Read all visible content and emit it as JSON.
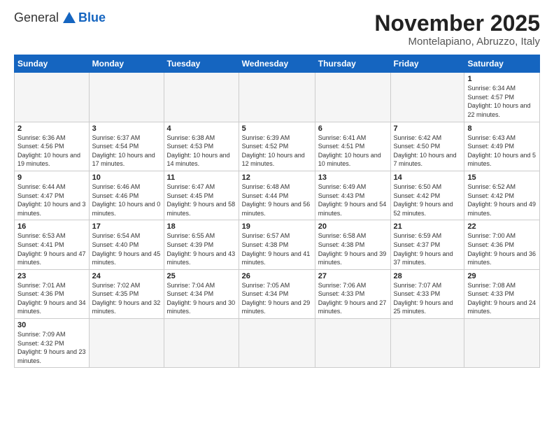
{
  "logo": {
    "general": "General",
    "blue": "Blue"
  },
  "title": "November 2025",
  "subtitle": "Montelapiano, Abruzzo, Italy",
  "days_header": [
    "Sunday",
    "Monday",
    "Tuesday",
    "Wednesday",
    "Thursday",
    "Friday",
    "Saturday"
  ],
  "weeks": [
    [
      {
        "num": "",
        "info": "",
        "empty": true
      },
      {
        "num": "",
        "info": "",
        "empty": true
      },
      {
        "num": "",
        "info": "",
        "empty": true
      },
      {
        "num": "",
        "info": "",
        "empty": true
      },
      {
        "num": "",
        "info": "",
        "empty": true
      },
      {
        "num": "",
        "info": "",
        "empty": true
      },
      {
        "num": "1",
        "info": "Sunrise: 6:34 AM\nSunset: 4:57 PM\nDaylight: 10 hours\nand 22 minutes."
      }
    ],
    [
      {
        "num": "2",
        "info": "Sunrise: 6:36 AM\nSunset: 4:56 PM\nDaylight: 10 hours\nand 19 minutes."
      },
      {
        "num": "3",
        "info": "Sunrise: 6:37 AM\nSunset: 4:54 PM\nDaylight: 10 hours\nand 17 minutes."
      },
      {
        "num": "4",
        "info": "Sunrise: 6:38 AM\nSunset: 4:53 PM\nDaylight: 10 hours\nand 14 minutes."
      },
      {
        "num": "5",
        "info": "Sunrise: 6:39 AM\nSunset: 4:52 PM\nDaylight: 10 hours\nand 12 minutes."
      },
      {
        "num": "6",
        "info": "Sunrise: 6:41 AM\nSunset: 4:51 PM\nDaylight: 10 hours\nand 10 minutes."
      },
      {
        "num": "7",
        "info": "Sunrise: 6:42 AM\nSunset: 4:50 PM\nDaylight: 10 hours\nand 7 minutes."
      },
      {
        "num": "8",
        "info": "Sunrise: 6:43 AM\nSunset: 4:49 PM\nDaylight: 10 hours\nand 5 minutes."
      }
    ],
    [
      {
        "num": "9",
        "info": "Sunrise: 6:44 AM\nSunset: 4:47 PM\nDaylight: 10 hours\nand 3 minutes."
      },
      {
        "num": "10",
        "info": "Sunrise: 6:46 AM\nSunset: 4:46 PM\nDaylight: 10 hours\nand 0 minutes."
      },
      {
        "num": "11",
        "info": "Sunrise: 6:47 AM\nSunset: 4:45 PM\nDaylight: 9 hours\nand 58 minutes."
      },
      {
        "num": "12",
        "info": "Sunrise: 6:48 AM\nSunset: 4:44 PM\nDaylight: 9 hours\nand 56 minutes."
      },
      {
        "num": "13",
        "info": "Sunrise: 6:49 AM\nSunset: 4:43 PM\nDaylight: 9 hours\nand 54 minutes."
      },
      {
        "num": "14",
        "info": "Sunrise: 6:50 AM\nSunset: 4:42 PM\nDaylight: 9 hours\nand 52 minutes."
      },
      {
        "num": "15",
        "info": "Sunrise: 6:52 AM\nSunset: 4:42 PM\nDaylight: 9 hours\nand 49 minutes."
      }
    ],
    [
      {
        "num": "16",
        "info": "Sunrise: 6:53 AM\nSunset: 4:41 PM\nDaylight: 9 hours\nand 47 minutes."
      },
      {
        "num": "17",
        "info": "Sunrise: 6:54 AM\nSunset: 4:40 PM\nDaylight: 9 hours\nand 45 minutes."
      },
      {
        "num": "18",
        "info": "Sunrise: 6:55 AM\nSunset: 4:39 PM\nDaylight: 9 hours\nand 43 minutes."
      },
      {
        "num": "19",
        "info": "Sunrise: 6:57 AM\nSunset: 4:38 PM\nDaylight: 9 hours\nand 41 minutes."
      },
      {
        "num": "20",
        "info": "Sunrise: 6:58 AM\nSunset: 4:38 PM\nDaylight: 9 hours\nand 39 minutes."
      },
      {
        "num": "21",
        "info": "Sunrise: 6:59 AM\nSunset: 4:37 PM\nDaylight: 9 hours\nand 37 minutes."
      },
      {
        "num": "22",
        "info": "Sunrise: 7:00 AM\nSunset: 4:36 PM\nDaylight: 9 hours\nand 36 minutes."
      }
    ],
    [
      {
        "num": "23",
        "info": "Sunrise: 7:01 AM\nSunset: 4:36 PM\nDaylight: 9 hours\nand 34 minutes."
      },
      {
        "num": "24",
        "info": "Sunrise: 7:02 AM\nSunset: 4:35 PM\nDaylight: 9 hours\nand 32 minutes."
      },
      {
        "num": "25",
        "info": "Sunrise: 7:04 AM\nSunset: 4:34 PM\nDaylight: 9 hours\nand 30 minutes."
      },
      {
        "num": "26",
        "info": "Sunrise: 7:05 AM\nSunset: 4:34 PM\nDaylight: 9 hours\nand 29 minutes."
      },
      {
        "num": "27",
        "info": "Sunrise: 7:06 AM\nSunset: 4:33 PM\nDaylight: 9 hours\nand 27 minutes."
      },
      {
        "num": "28",
        "info": "Sunrise: 7:07 AM\nSunset: 4:33 PM\nDaylight: 9 hours\nand 25 minutes."
      },
      {
        "num": "29",
        "info": "Sunrise: 7:08 AM\nSunset: 4:33 PM\nDaylight: 9 hours\nand 24 minutes."
      }
    ],
    [
      {
        "num": "30",
        "info": "Sunrise: 7:09 AM\nSunset: 4:32 PM\nDaylight: 9 hours\nand 23 minutes."
      },
      {
        "num": "",
        "info": "",
        "empty": true
      },
      {
        "num": "",
        "info": "",
        "empty": true
      },
      {
        "num": "",
        "info": "",
        "empty": true
      },
      {
        "num": "",
        "info": "",
        "empty": true
      },
      {
        "num": "",
        "info": "",
        "empty": true
      },
      {
        "num": "",
        "info": "",
        "empty": true
      }
    ]
  ]
}
